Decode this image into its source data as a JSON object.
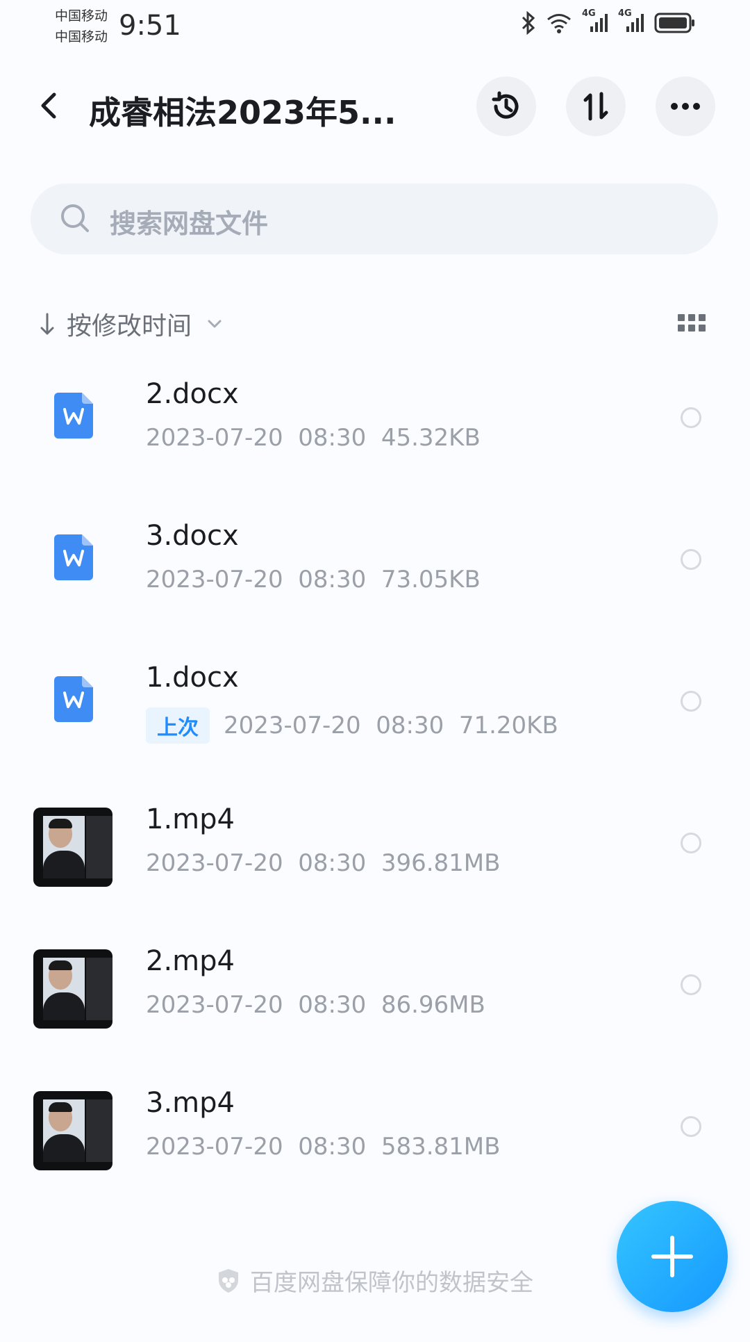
{
  "status_bar": {
    "carrier1": "中国移动",
    "carrier2": "中国移动",
    "time": "9:51",
    "network1": "4G",
    "network2": "4G"
  },
  "header": {
    "title": "成睿相法2023年5..."
  },
  "search": {
    "placeholder": "搜索网盘文件"
  },
  "sort": {
    "label": "按修改时间"
  },
  "files": [
    {
      "name": "2.docx",
      "date": "2023-07-20",
      "time": "08:30",
      "size": "45.32KB",
      "type": "doc",
      "badge": ""
    },
    {
      "name": "3.docx",
      "date": "2023-07-20",
      "time": "08:30",
      "size": "73.05KB",
      "type": "doc",
      "badge": ""
    },
    {
      "name": "1.docx",
      "date": "2023-07-20",
      "time": "08:30",
      "size": "71.20KB",
      "type": "doc",
      "badge": "上次"
    },
    {
      "name": "1.mp4",
      "date": "2023-07-20",
      "time": "08:30",
      "size": "396.81MB",
      "type": "video",
      "badge": ""
    },
    {
      "name": "2.mp4",
      "date": "2023-07-20",
      "time": "08:30",
      "size": "86.96MB",
      "type": "video",
      "badge": ""
    },
    {
      "name": "3.mp4",
      "date": "2023-07-20",
      "time": "08:30",
      "size": "583.81MB",
      "type": "video",
      "badge": ""
    }
  ],
  "footer": {
    "text": "百度网盘保障你的数据安全"
  },
  "colors": {
    "accent": "#1f8cff",
    "doc_icon": "#3f8cf5"
  }
}
